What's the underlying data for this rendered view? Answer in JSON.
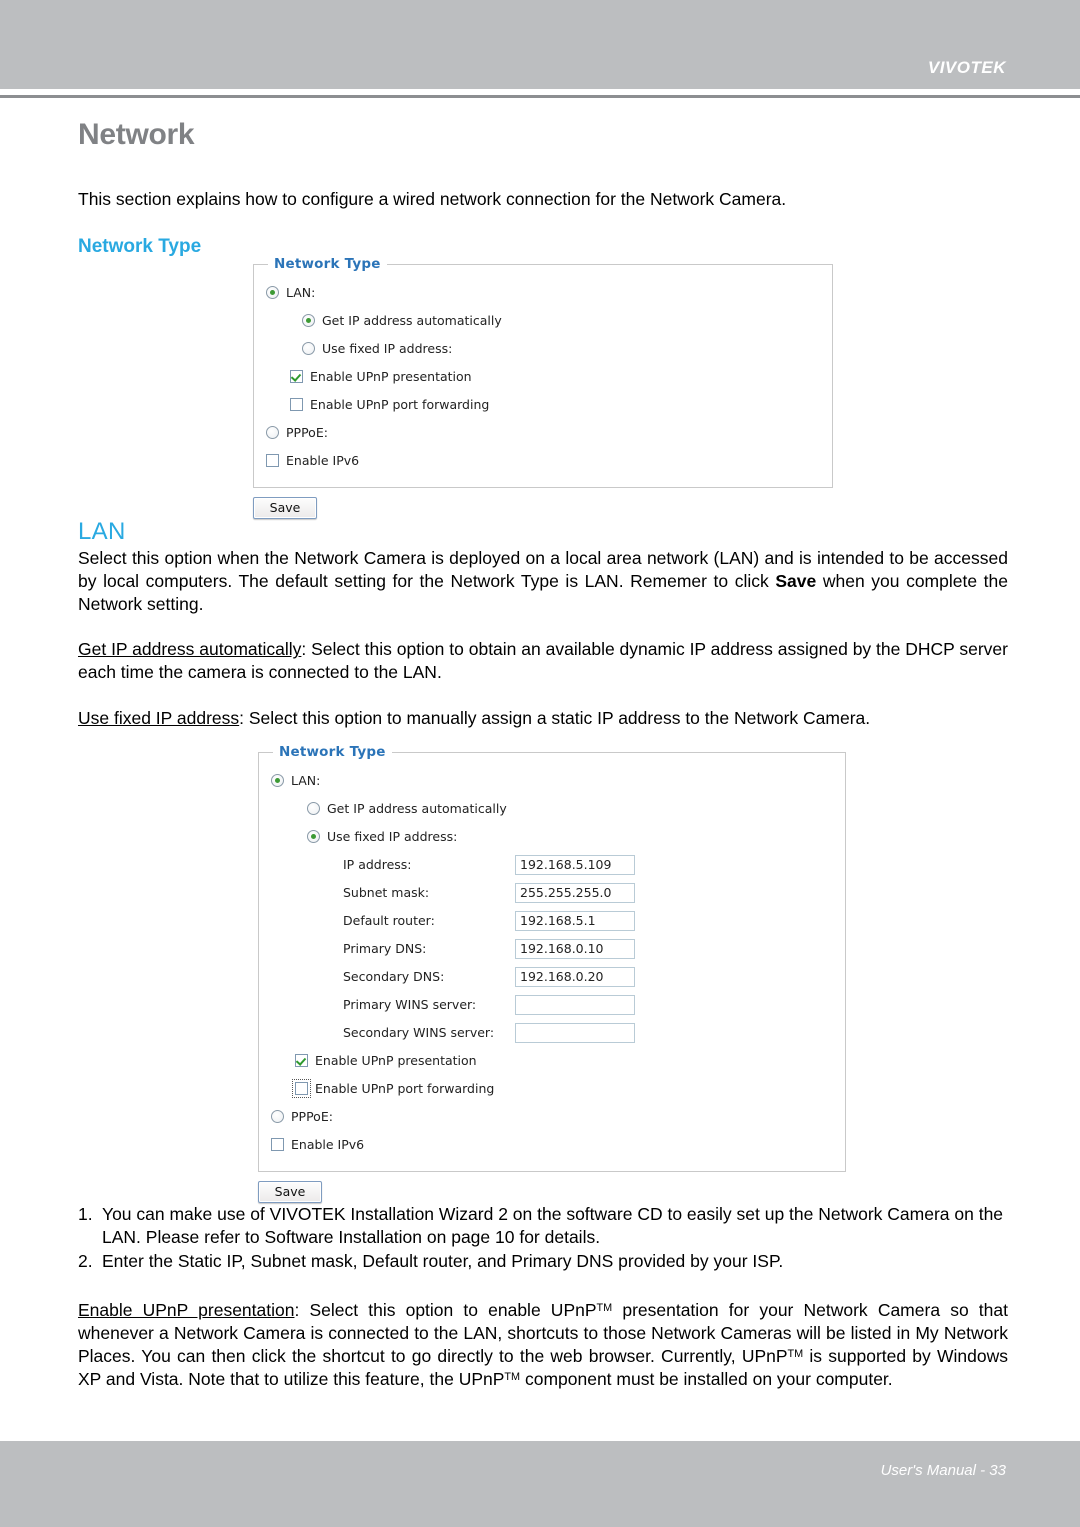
{
  "header": {
    "brand": "VIVOTEK"
  },
  "page": {
    "title": "Network",
    "intro": "This section explains how to configure a wired network connection for the Network Camera.",
    "section_network_type": "Network Type",
    "section_lan": "LAN"
  },
  "panel1": {
    "legend": "Network Type",
    "lan_label": "LAN:",
    "lan_selected": true,
    "get_ip_label": "Get IP address automatically",
    "get_ip_selected": true,
    "fixed_ip_label": "Use fixed IP address:",
    "fixed_ip_selected": false,
    "upnp_presentation_label": "Enable UPnP presentation",
    "upnp_presentation_checked": true,
    "upnp_forwarding_label": "Enable UPnP port forwarding",
    "upnp_forwarding_checked": false,
    "pppoe_label": "PPPoE:",
    "pppoe_selected": false,
    "ipv6_label": "Enable IPv6",
    "ipv6_checked": false,
    "save_label": "Save"
  },
  "panel2": {
    "legend": "Network Type",
    "lan_label": "LAN:",
    "lan_selected": true,
    "get_ip_label": "Get IP address automatically",
    "get_ip_selected": false,
    "fixed_ip_label": "Use fixed IP address:",
    "fixed_ip_selected": true,
    "fields": [
      {
        "label": "IP address:",
        "value": "192.168.5.109"
      },
      {
        "label": "Subnet mask:",
        "value": "255.255.255.0"
      },
      {
        "label": "Default router:",
        "value": "192.168.5.1"
      },
      {
        "label": "Primary DNS:",
        "value": "192.168.0.10"
      },
      {
        "label": "Secondary DNS:",
        "value": "192.168.0.20"
      },
      {
        "label": "Primary WINS server:",
        "value": ""
      },
      {
        "label": "Secondary WINS server:",
        "value": ""
      }
    ],
    "upnp_presentation_label": "Enable UPnP presentation",
    "upnp_presentation_checked": true,
    "upnp_forwarding_label": "Enable UPnP port forwarding",
    "upnp_forwarding_checked": false,
    "pppoe_label": "PPPoE:",
    "pppoe_selected": false,
    "ipv6_label": "Enable IPv6",
    "ipv6_checked": false,
    "save_label": "Save"
  },
  "body": {
    "lan_paragraph_prefix": "Select this option when the Network Camera is deployed on a local area network (LAN) and is intended to be accessed by local computers. The default setting for the Network Type is LAN. Rememer to click ",
    "lan_paragraph_bold": "Save",
    "lan_paragraph_suffix": " when you complete the Network setting.",
    "get_ip_term": "Get IP address automatically",
    "get_ip_desc": ": Select this option to obtain an available dynamic IP address assigned by the DHCP server each time the camera is connected to the LAN.",
    "fixed_ip_term": "Use fixed IP address",
    "fixed_ip_desc": ": Select this option to manually assign a static IP address to the Network Camera.",
    "note1_num": "1.",
    "note1_text": "You can make use of VIVOTEK Installation Wizard 2 on the software CD to easily set up the Network Camera on the LAN. Please refer to Software Installation on page 10 for details.",
    "note2_num": "2.",
    "note2_text": "Enter the Static IP, Subnet mask, Default router, and Primary DNS provided by your ISP.",
    "upnp_term": "Enable UPnP presentation",
    "upnp_part1": ": Select this option to enable UPnP",
    "upnp_tm1": "TM",
    "upnp_part2": " presentation for your Network Camera so that whenever a Network Camera is connected to the LAN, shortcuts to those Network Cameras will be listed in My Network Places. You can then click the shortcut to go directly to the web browser. Currently, UPnP",
    "upnp_tm2": "TM",
    "upnp_part3": " is supported by Windows XP and Vista. Note that to utilize this feature,  the UPnP",
    "upnp_tm3": "TM",
    "upnp_part4": " component must be installed on your computer."
  },
  "footer": {
    "text": "User's Manual - 33"
  }
}
